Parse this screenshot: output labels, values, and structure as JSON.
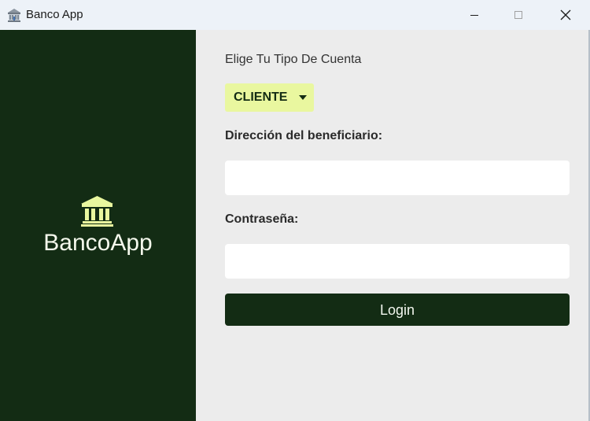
{
  "window": {
    "title": "Banco App",
    "app_icon": "bank-building-icon",
    "controls": [
      "minimize-icon",
      "maximize-icon",
      "close-icon"
    ]
  },
  "sidebar": {
    "icon": "bank-icon",
    "brand_name": "BancoApp"
  },
  "form": {
    "account_type_label": "Elige Tu Tipo De Cuenta",
    "account_type_selected": "CLIENTE",
    "address_label": "Dirección del beneficiario:",
    "address_value": "",
    "password_label": "Contraseña:",
    "password_value": "",
    "login_label": "Login"
  },
  "colors": {
    "primary_dark_green": "#132c14",
    "accent_yellow": "#e9f79f",
    "form_background": "#ececec",
    "input_background": "#ffffff"
  }
}
